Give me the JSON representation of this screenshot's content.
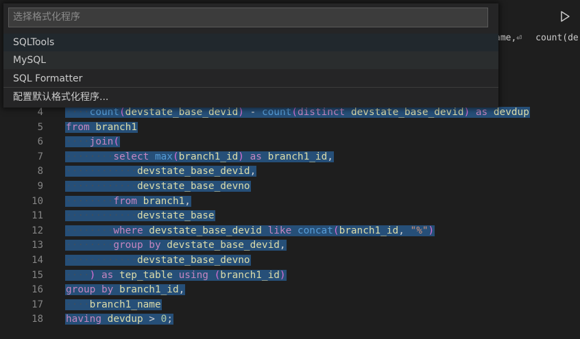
{
  "editor": {
    "topright_tokens": [
      "ame,⏎",
      "count(de"
    ],
    "lines": [
      {
        "num": "4",
        "indent": 2,
        "tokens": [
          [
            "fn",
            "count"
          ],
          [
            "par",
            "("
          ],
          [
            "id",
            "devstate_base_devid"
          ],
          [
            "par",
            ")"
          ],
          [
            "pu",
            " - "
          ],
          [
            "fn",
            "count"
          ],
          [
            "par",
            "("
          ],
          [
            "kw",
            "distinct "
          ],
          [
            "id",
            "devstate_base_devid"
          ],
          [
            "par",
            ")"
          ],
          [
            "kw",
            " as "
          ],
          [
            "id",
            "devdup"
          ]
        ]
      },
      {
        "num": "5",
        "indent": 0,
        "tokens": [
          [
            "kw",
            "from "
          ],
          [
            "id",
            "branch1"
          ]
        ]
      },
      {
        "num": "6",
        "indent": 2,
        "tokens": [
          [
            "kw",
            "join"
          ],
          [
            "par",
            "("
          ]
        ]
      },
      {
        "num": "7",
        "indent": 4,
        "tokens": [
          [
            "kw",
            "select "
          ],
          [
            "fn",
            "max"
          ],
          [
            "par",
            "("
          ],
          [
            "id",
            "branch1_id"
          ],
          [
            "par",
            ")"
          ],
          [
            "kw",
            " as "
          ],
          [
            "id",
            "branch1_id"
          ],
          [
            "pu",
            ","
          ]
        ]
      },
      {
        "num": "8",
        "indent": 6,
        "tokens": [
          [
            "id",
            "devstate_base_devid"
          ],
          [
            "pu",
            ","
          ]
        ]
      },
      {
        "num": "9",
        "indent": 6,
        "tokens": [
          [
            "id",
            "devstate_base_devno"
          ]
        ]
      },
      {
        "num": "10",
        "indent": 4,
        "tokens": [
          [
            "kw",
            "from "
          ],
          [
            "id",
            "branch1"
          ],
          [
            "pu",
            ","
          ]
        ]
      },
      {
        "num": "11",
        "indent": 6,
        "tokens": [
          [
            "id",
            "devstate_base"
          ]
        ]
      },
      {
        "num": "12",
        "indent": 4,
        "tokens": [
          [
            "kw",
            "where "
          ],
          [
            "id",
            "devstate_base_devid"
          ],
          [
            "kw",
            " like "
          ],
          [
            "fn",
            "concat"
          ],
          [
            "par",
            "("
          ],
          [
            "id",
            "branch1_id"
          ],
          [
            "pu",
            ", "
          ],
          [
            "st",
            "\"%\""
          ],
          [
            "par",
            ")"
          ]
        ]
      },
      {
        "num": "13",
        "indent": 4,
        "tokens": [
          [
            "kw",
            "group by "
          ],
          [
            "id",
            "devstate_base_devid"
          ],
          [
            "pu",
            ","
          ]
        ]
      },
      {
        "num": "14",
        "indent": 6,
        "tokens": [
          [
            "id",
            "devstate_base_devno"
          ]
        ]
      },
      {
        "num": "15",
        "indent": 2,
        "tokens": [
          [
            "par",
            ")"
          ],
          [
            "kw",
            " as "
          ],
          [
            "id",
            "tep_table "
          ],
          [
            "kw",
            "using "
          ],
          [
            "par",
            "("
          ],
          [
            "id",
            "branch1_id"
          ],
          [
            "par",
            ")"
          ]
        ]
      },
      {
        "num": "16",
        "indent": 0,
        "tokens": [
          [
            "kw",
            "group by "
          ],
          [
            "id",
            "branch1_id"
          ],
          [
            "pu",
            ","
          ]
        ]
      },
      {
        "num": "17",
        "indent": 2,
        "tokens": [
          [
            "id",
            "branch1_name"
          ]
        ]
      },
      {
        "num": "18",
        "indent": 0,
        "tokens": [
          [
            "kw",
            "having "
          ],
          [
            "id",
            "devdup"
          ],
          [
            "pu",
            " > "
          ],
          [
            "nm",
            "0"
          ],
          [
            "pu",
            ";"
          ]
        ]
      }
    ]
  },
  "quickpick": {
    "placeholder": "选择格式化程序",
    "items": [
      {
        "label": "SQLTools",
        "state": "active"
      },
      {
        "label": "MySQL",
        "state": "hover"
      },
      {
        "label": "SQL Formatter",
        "state": ""
      },
      {
        "label": "配置默认格式化程序...",
        "state": ""
      }
    ]
  },
  "icons": {
    "run": "play-icon"
  },
  "colors": {
    "background": "#1e1e1e",
    "selection": "#264f78",
    "keyword": "#c586c0",
    "function": "#569cd6",
    "identifier": "#dcdcaa"
  }
}
